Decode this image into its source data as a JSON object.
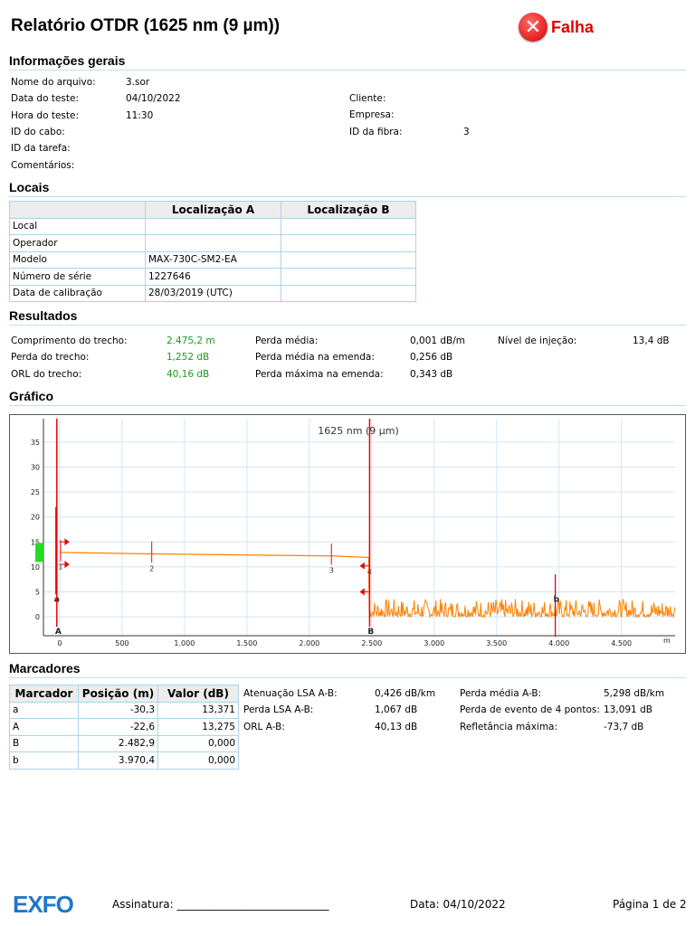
{
  "title": "Relatório OTDR (1625 nm (9 µm))",
  "status": {
    "label": "Falha",
    "icon": "fail-x-icon",
    "color": "#e00000"
  },
  "general": {
    "heading": "Informações gerais",
    "fields": [
      {
        "label": "Nome do arquivo:",
        "value": "3.sor"
      },
      {
        "label": "Data do teste:",
        "value": "04/10/2022"
      },
      {
        "label": "Hora do teste:",
        "value": "11:30"
      },
      {
        "label": "ID do cabo:",
        "value": ""
      },
      {
        "label": "ID da tarefa:",
        "value": ""
      },
      {
        "label": "Comentários:",
        "value": ""
      }
    ],
    "right_fields": [
      {
        "label": "Cliente:",
        "value": ""
      },
      {
        "label": "Empresa:",
        "value": ""
      },
      {
        "label": "ID da fibra:",
        "value": "3"
      }
    ]
  },
  "locations": {
    "heading": "Locais",
    "headers": [
      "",
      "Localização A",
      "Localização B"
    ],
    "rows": [
      [
        "Local",
        "",
        ""
      ],
      [
        "Operador",
        "",
        ""
      ],
      [
        "Modelo",
        "MAX-730C-SM2-EA",
        ""
      ],
      [
        "Número de série",
        "1227646",
        ""
      ],
      [
        "Data de calibração",
        "28/03/2019 (UTC)",
        ""
      ]
    ]
  },
  "results": {
    "heading": "Resultados",
    "col1": [
      {
        "label": "Comprimento do trecho:",
        "value": "2.475,2 m"
      },
      {
        "label": "Perda do trecho:",
        "value": "1,252 dB"
      },
      {
        "label": "ORL do trecho:",
        "value": "40,16 dB"
      }
    ],
    "col2": [
      {
        "label": "Perda média:",
        "value": "0,001 dB/m"
      },
      {
        "label": "Perda média na emenda:",
        "value": "0,256 dB"
      },
      {
        "label": "Perda máxima na emenda:",
        "value": "0,343 dB"
      }
    ],
    "col3": [
      {
        "label": "Nível de injeção:",
        "value": "13,4 dB"
      }
    ]
  },
  "graph_heading": "Gráfico",
  "chart_data": {
    "type": "line",
    "title": "1625 nm (9 µm)",
    "xlabel": "m",
    "ylabel": "",
    "xlim": [
      -130,
      4930
    ],
    "ylim": [
      -3.8,
      39.7
    ],
    "grid": true,
    "xticks": [
      0,
      500,
      1000,
      1500,
      2000,
      2500,
      3000,
      3500,
      4000,
      4500
    ],
    "xtick_labels": [
      "0",
      "500",
      "1.000",
      "1.500",
      "2.000",
      "2.500",
      "3.000",
      "3.500",
      "4.000",
      "4.500"
    ],
    "yticks": [
      0,
      5,
      10,
      15,
      20,
      25,
      30,
      35
    ],
    "ytick_labels": [
      "0",
      "5",
      "10",
      "15",
      "20",
      "25",
      "30",
      "35"
    ],
    "trace": {
      "name": "1625 nm",
      "color": "#ff8000",
      "x": [
        0,
        730,
        2170,
        2475
      ],
      "y": [
        12.9,
        12.6,
        12.2,
        11.9
      ],
      "noise_start": 2480,
      "noise_end": 4930,
      "noise_range": [
        0,
        4
      ]
    },
    "events": [
      {
        "label": "1",
        "x": 0
      },
      {
        "label": "2",
        "x": 730
      },
      {
        "label": "3",
        "x": 2170
      },
      {
        "label": "4",
        "x": 2475
      }
    ],
    "markers": [
      {
        "label": "a",
        "x": -30.3
      },
      {
        "label": "A",
        "x": -22.6
      },
      {
        "label": "B",
        "x": 2482.9
      },
      {
        "label": "b",
        "x": 3970.4
      }
    ],
    "injection_level": 13.4
  },
  "markers": {
    "heading": "Marcadores",
    "headers": [
      "Marcador",
      "Posição (m)",
      "Valor (dB)"
    ],
    "rows": [
      [
        "a",
        "-30,3",
        "13,371"
      ],
      [
        "A",
        "-22,6",
        "13,275"
      ],
      [
        "B",
        "2.482,9",
        "0,000"
      ],
      [
        "b",
        "3.970,4",
        "0,000"
      ]
    ],
    "col1": [
      {
        "label": "Atenuação LSA A-B:",
        "value": "0,426 dB/km"
      },
      {
        "label": "Perda LSA A-B:",
        "value": "1,067 dB"
      },
      {
        "label": "ORL A-B:",
        "value": "40,13 dB"
      }
    ],
    "col2": [
      {
        "label": "Perda média A-B:",
        "value": "5,298 dB/km"
      },
      {
        "label": "Perda de evento de 4 pontos:",
        "value": "13,091 dB"
      },
      {
        "label": "Refletância máxima:",
        "value": "-73,7 dB"
      }
    ]
  },
  "footer": {
    "logo": "EXFO",
    "signature": "Assinatura: ____________________________",
    "date": "Data: 04/10/2022",
    "page": "Página 1 de 2"
  }
}
